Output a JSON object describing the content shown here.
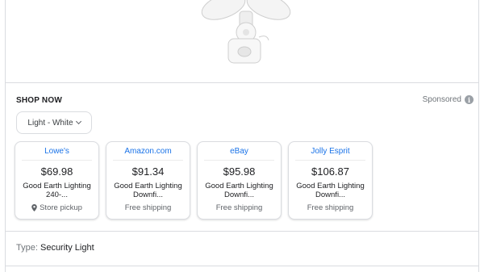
{
  "shop": {
    "header": "SHOP NOW",
    "sponsored_label": "Sponsored",
    "info_icon": "info-icon",
    "variant_label": "Light - White",
    "offers": [
      {
        "merchant": "Lowe's",
        "price": "$69.98",
        "title": "Good Earth Lighting 240-...",
        "shipping": "Store pickup",
        "icon": "location-pin-icon"
      },
      {
        "merchant": "Amazon.com",
        "price": "$91.34",
        "title": "Good Earth Lighting Downfi...",
        "shipping": "Free shipping"
      },
      {
        "merchant": "eBay",
        "price": "$95.98",
        "title": "Good Earth Lighting Downfi...",
        "shipping": "Free shipping"
      },
      {
        "merchant": "Jolly Esprit",
        "price": "$106.87",
        "title": "Good Earth Lighting Downfi...",
        "shipping": "Free shipping"
      }
    ]
  },
  "details": {
    "type_key": "Type",
    "type_value": "Security Light"
  },
  "colors": {
    "link": "#1a73e8",
    "border": "#dadce0",
    "muted": "#70757a"
  }
}
